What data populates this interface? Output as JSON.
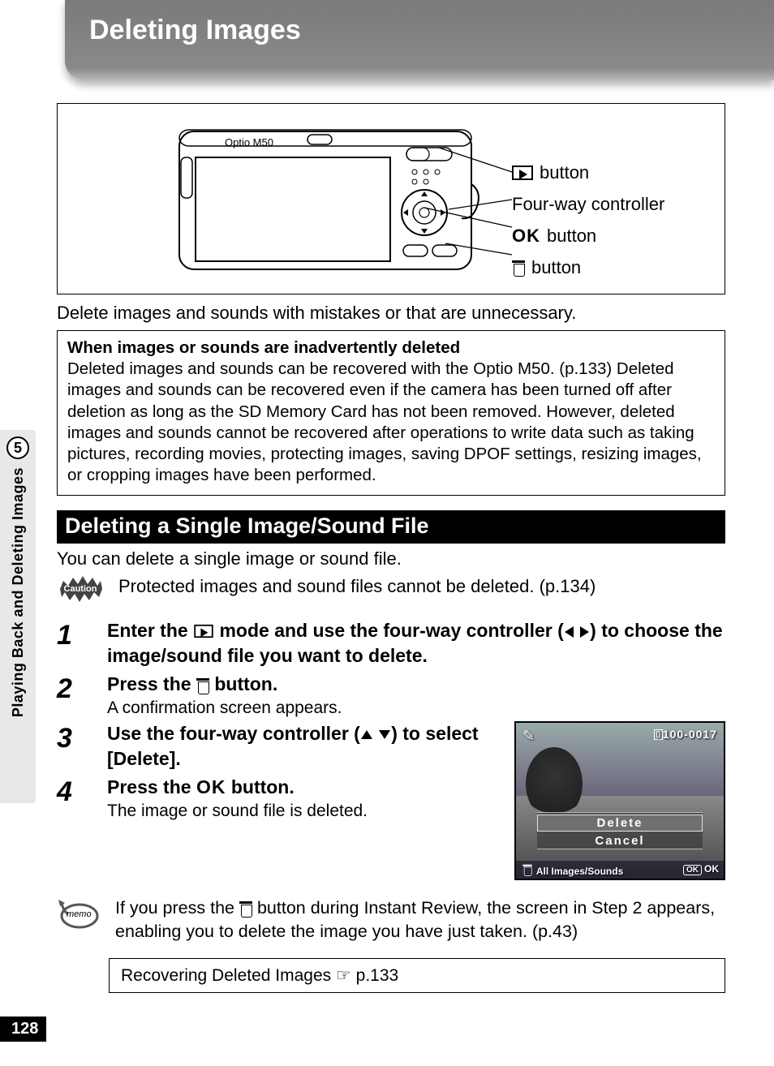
{
  "title": "Deleting Images",
  "camera": {
    "model_label": "Optio M50",
    "callouts": {
      "play_button": "button",
      "four_way": "Four-way controller",
      "ok_label": "OK",
      "ok_button": "button",
      "trash_button": "button"
    }
  },
  "lead": "Delete images and sounds with mistakes or that are unnecessary.",
  "info_box": {
    "heading": "When images or sounds are inadvertently deleted",
    "body": "Deleted images and sounds can be recovered with the Optio M50. (p.133) Deleted images and sounds can be recovered even if the camera has been turned off after deletion as long as the SD Memory Card has not been removed. However, deleted images and sounds cannot be recovered after operations to write data such as taking pictures, recording movies, protecting images, saving DPOF settings, resizing images, or cropping images have been performed."
  },
  "section": "Deleting a Single Image/Sound File",
  "sub_lead": "You can delete a single image or sound file.",
  "caution": {
    "label": "Caution",
    "text": "Protected images and sound files cannot be deleted. (p.134)"
  },
  "steps": {
    "s1_a": "Enter the ",
    "s1_b": " mode and use the four-way controller (",
    "s1_c": ") to choose the image/sound file you want to delete.",
    "s2_a": "Press the ",
    "s2_b": " button.",
    "s2_desc": "A confirmation screen appears.",
    "s3_a": "Use the four-way controller (",
    "s3_b": ") to select [Delete].",
    "s4_a": "Press the ",
    "s4_ok": "OK",
    "s4_b": " button.",
    "s4_desc": "The image or sound file is deleted."
  },
  "lcd": {
    "file_no": "100-0017",
    "menu_delete": "Delete",
    "menu_cancel": "Cancel",
    "footer_left": "All Images/Sounds",
    "footer_ok_box": "OK",
    "footer_ok": "OK"
  },
  "memo": {
    "label": "memo",
    "text_a": "If you press the ",
    "text_b": " button during Instant Review, the screen in Step 2 appears, enabling you to delete the image you have just taken. (p.43)"
  },
  "xref": {
    "text": "Recovering Deleted Images",
    "page": "p.133"
  },
  "side": {
    "chapter": "5",
    "label": "Playing Back and Deleting Images"
  },
  "page_number": "128"
}
